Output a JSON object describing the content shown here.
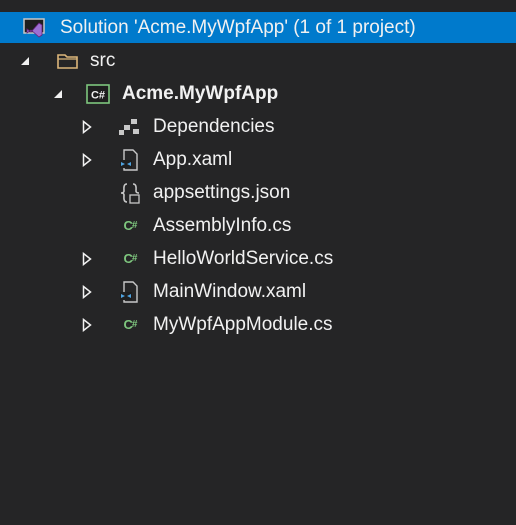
{
  "solution": {
    "label": "Solution 'Acme.MyWpfApp' (1 of 1 project)",
    "icon": "visual-studio-solution-icon"
  },
  "folder": {
    "label": "src",
    "icon": "folder-icon",
    "expanded": true
  },
  "project": {
    "label": "Acme.MyWpfApp",
    "icon": "csharp-project-icon",
    "expanded": true
  },
  "items": [
    {
      "label": "Dependencies",
      "icon": "dependencies-icon",
      "expandable": true
    },
    {
      "label": "App.xaml",
      "icon": "xaml-file-icon",
      "expandable": true
    },
    {
      "label": "appsettings.json",
      "icon": "json-file-icon",
      "expandable": false
    },
    {
      "label": "AssemblyInfo.cs",
      "icon": "csharp-file-icon",
      "expandable": false
    },
    {
      "label": "HelloWorldService.cs",
      "icon": "csharp-file-icon",
      "expandable": true
    },
    {
      "label": "MainWindow.xaml",
      "icon": "xaml-file-icon",
      "expandable": true
    },
    {
      "label": "MyWpfAppModule.cs",
      "icon": "csharp-file-icon",
      "expandable": true
    }
  ],
  "colors": {
    "background": "#252526",
    "selection": "#007acc",
    "text": "#f1f1f1",
    "csharp_green": "#7ec67e",
    "folder_yellow": "#dcb67a"
  }
}
